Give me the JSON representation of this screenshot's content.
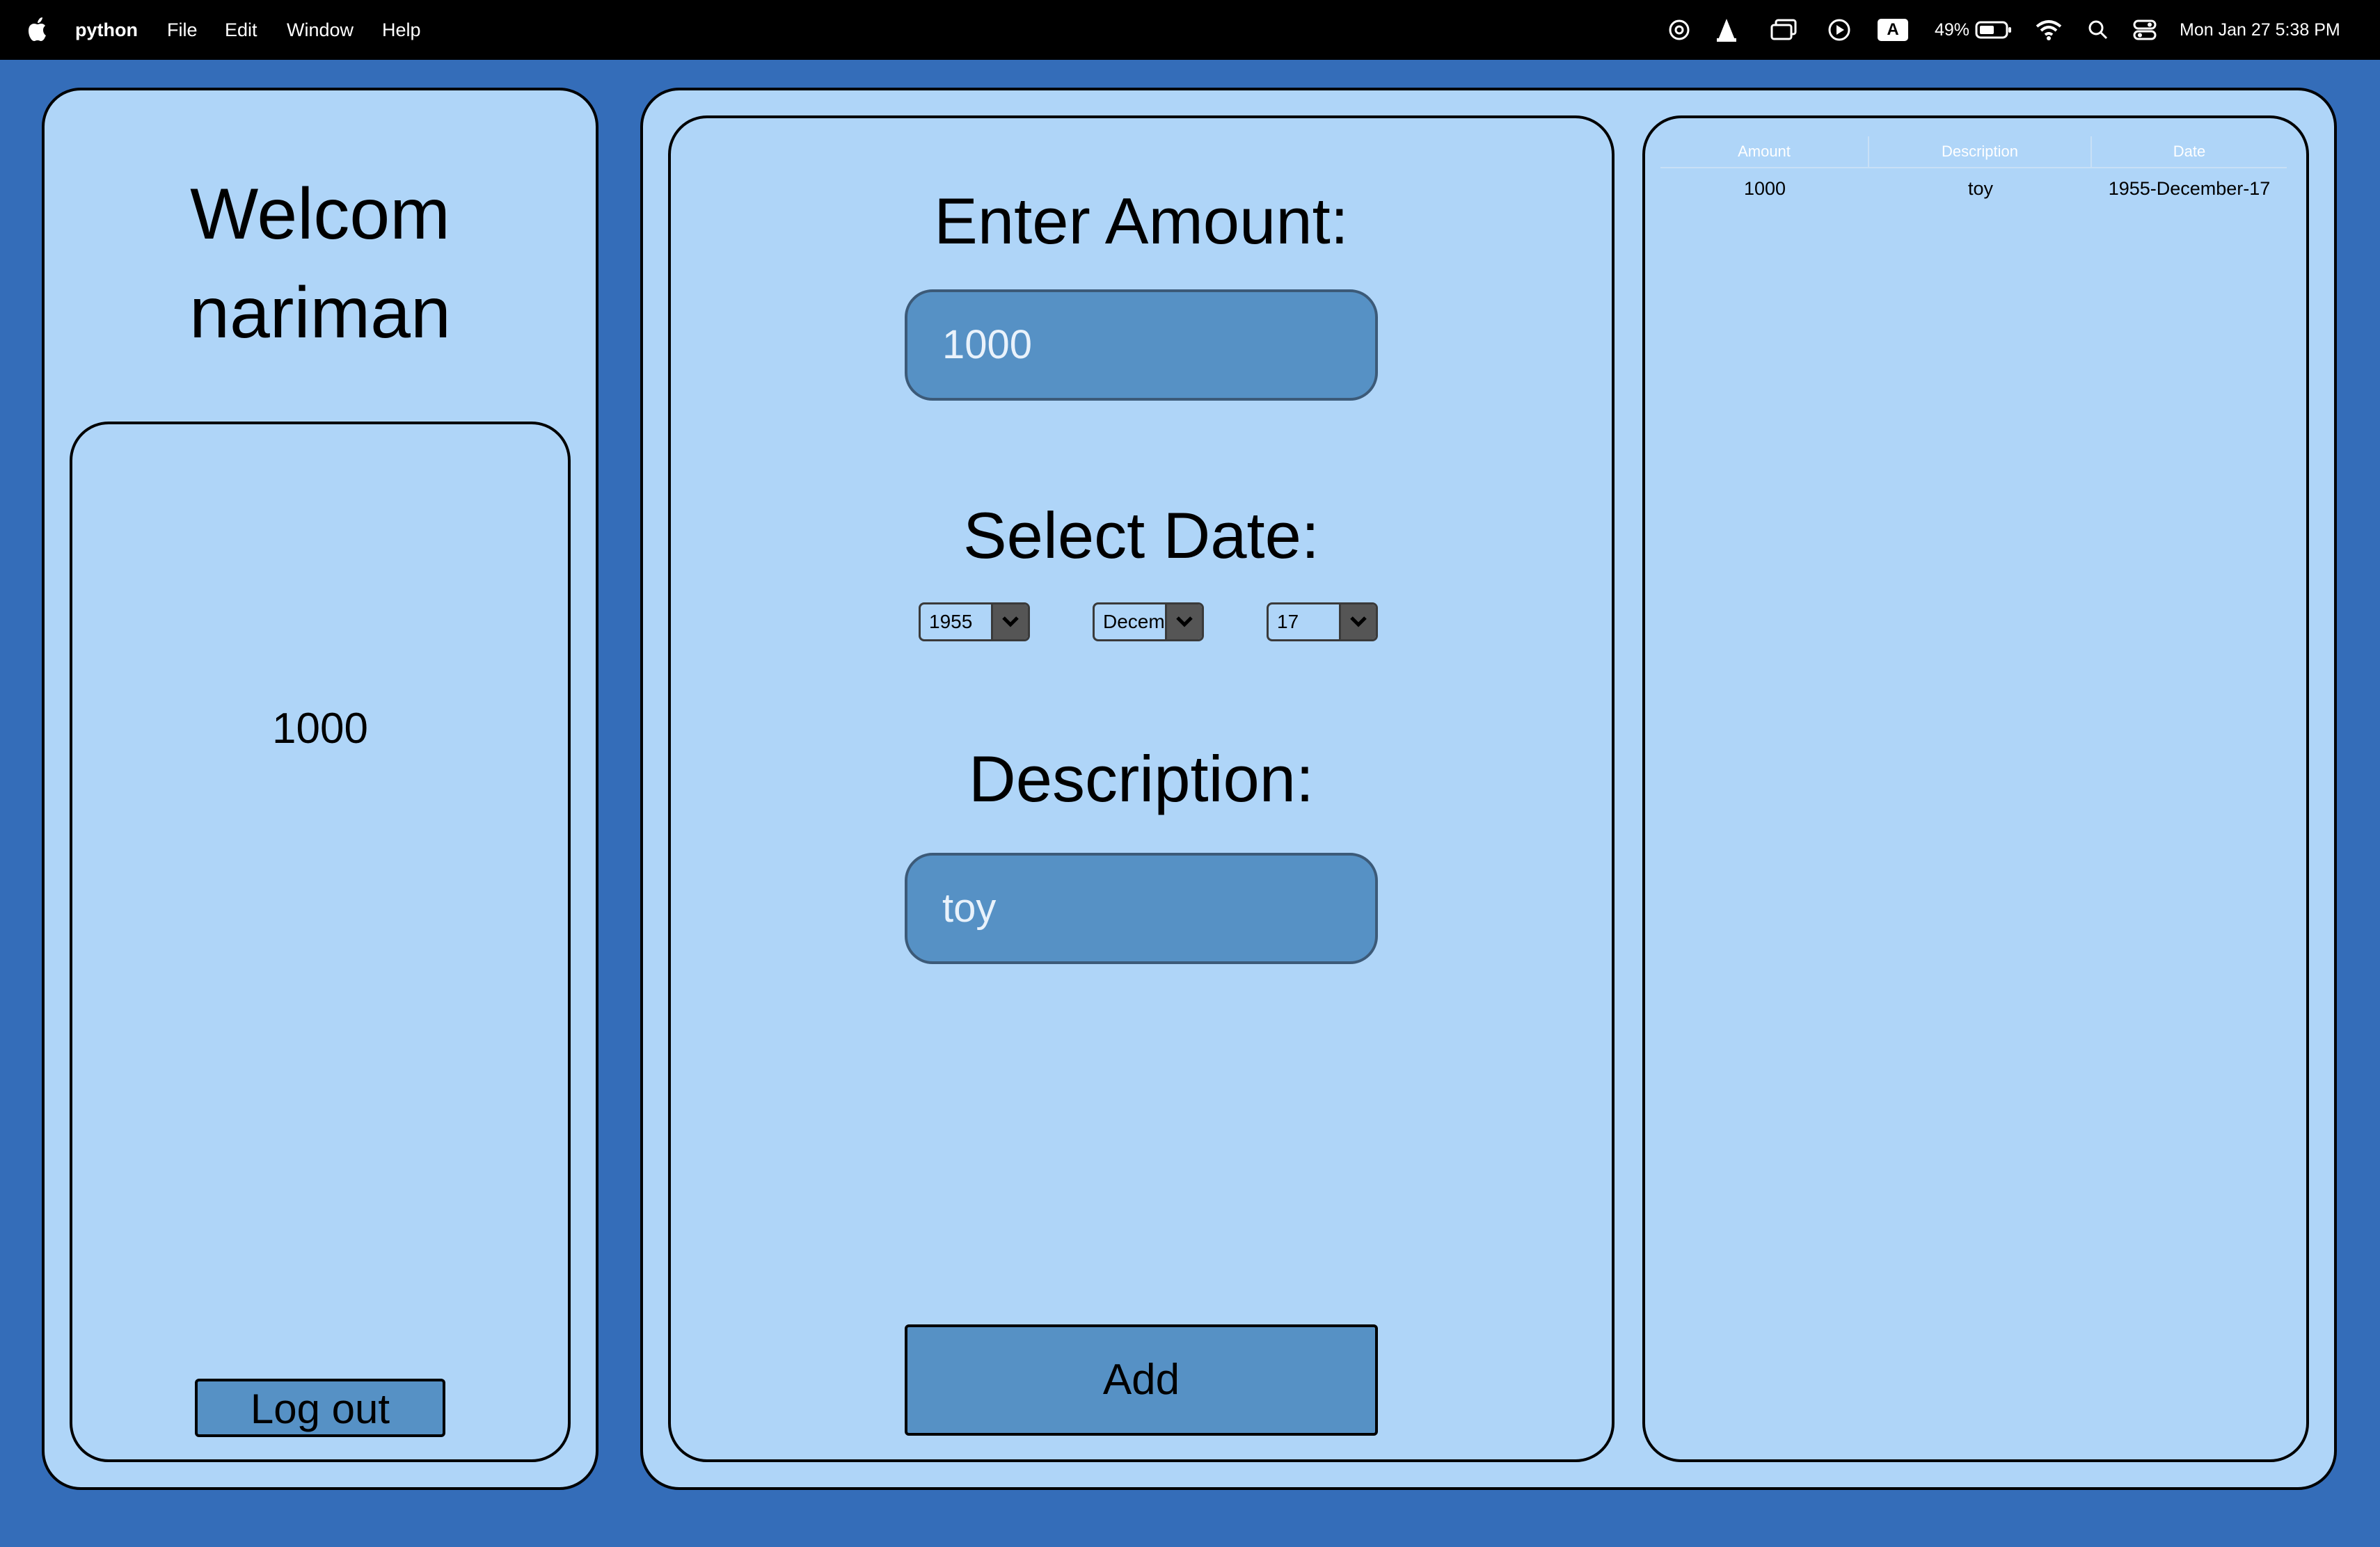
{
  "menubar": {
    "app_name": "python",
    "items": [
      "File",
      "Edit",
      "Window",
      "Help"
    ],
    "battery_percent": "49%",
    "clock": "Mon Jan 27  5:38 PM",
    "input_source": "A"
  },
  "sidebar": {
    "welcome_line1": "Welcom",
    "welcome_line2": "nariman",
    "balance": "1000",
    "logout_label": "Log out"
  },
  "form": {
    "amount_label": "Enter Amount:",
    "amount_value": "1000",
    "date_label": "Select Date:",
    "year_value": "1955",
    "month_value": "Decem",
    "day_value": "17",
    "description_label": "Description:",
    "description_value": "toy",
    "add_label": "Add"
  },
  "table": {
    "columns": [
      "Amount",
      "Description",
      "Date"
    ],
    "rows": [
      [
        "1000",
        "toy",
        "1955-December-17"
      ]
    ]
  },
  "colors": {
    "background": "#346db9",
    "panel": "#afd5f8",
    "input": "#5691c5"
  }
}
